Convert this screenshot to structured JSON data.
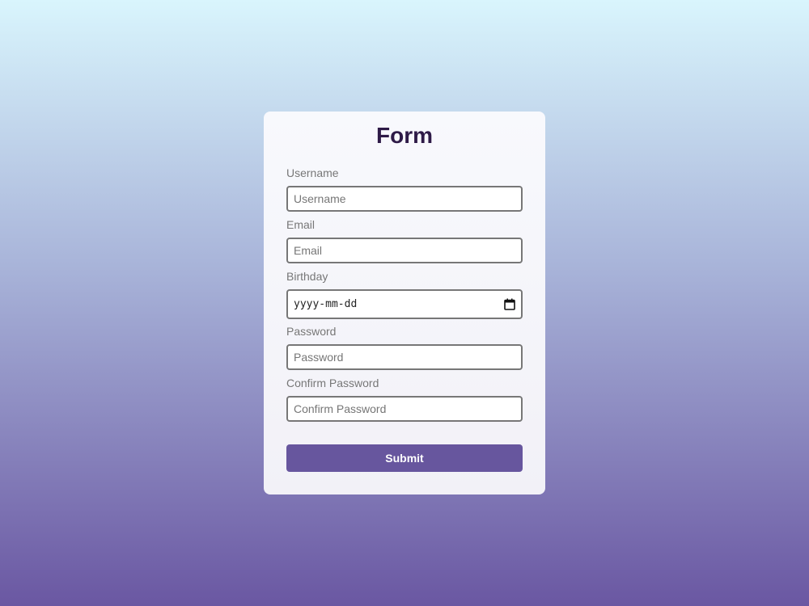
{
  "form": {
    "title": "Form",
    "fields": [
      {
        "label": "Username",
        "placeholder": "Username"
      },
      {
        "label": "Email",
        "placeholder": "Email"
      },
      {
        "label": "Birthday",
        "placeholder": "yyyy-mm-dd"
      },
      {
        "label": "Password",
        "placeholder": "Password"
      },
      {
        "label": "Confirm Password",
        "placeholder": "Confirm Password"
      }
    ],
    "submit_label": "Submit",
    "accent": "#67569e"
  }
}
